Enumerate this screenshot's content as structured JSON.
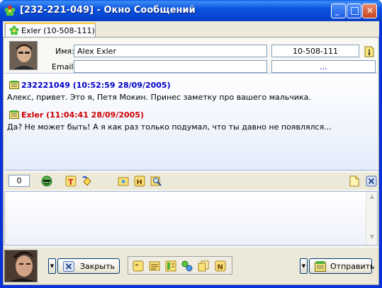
{
  "window": {
    "title": "[232-221-049] - Окно Сообщений",
    "minimize_label": "_",
    "maximize_label": "□",
    "close_label": "✕"
  },
  "tab": {
    "label": "Exler (10-508-111)"
  },
  "contact": {
    "name_label": "Имя:",
    "name_value": "Alex  Exler",
    "email_label": "Email:",
    "email_value": "",
    "uin_value": "10-508-111",
    "extra_value": "..."
  },
  "messages": [
    {
      "sender": "232221049",
      "time": "(10:52:59 28/09/2005)",
      "text": "Алекс, привет. Это я, Петя Мокин. Принес заметку про вашего мальчика.",
      "color": "#0000c8"
    },
    {
      "sender": "Exler",
      "time": "(11:04:41 28/09/2005)",
      "text": "Да? Не может быть! А я как раз только подумал, что ты давно не появлялся...",
      "color": "#d00000"
    }
  ],
  "toolbar": {
    "counter": "0"
  },
  "input": {
    "value": ""
  },
  "buttons": {
    "close_label": "Закрыть",
    "send_label": "Отправить"
  },
  "colors": {
    "titlebar": "#0b54e0",
    "outgoing_sender": "#0000c8",
    "incoming_sender": "#d00000",
    "history_bg": "#e4ecfb"
  }
}
